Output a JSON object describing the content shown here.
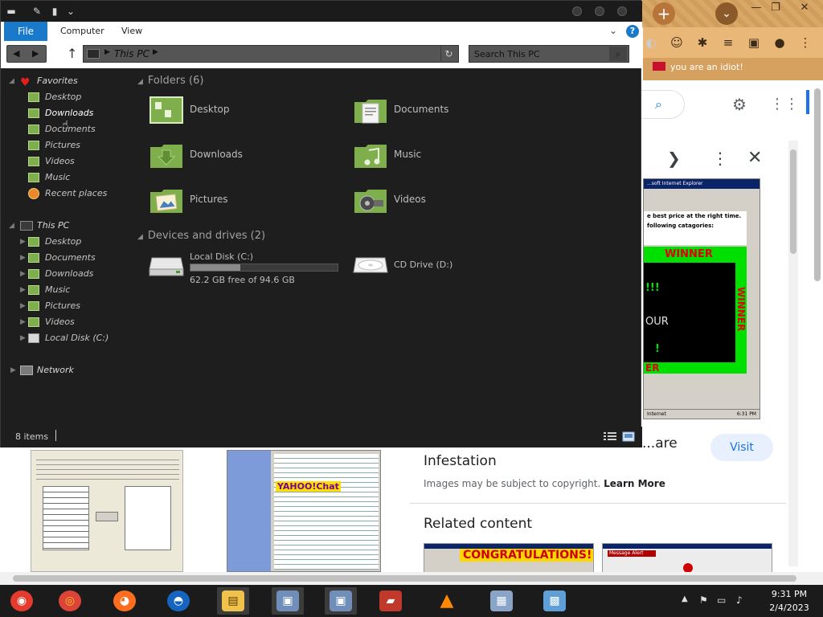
{
  "browser": {
    "new_tab_symbol": "+",
    "bookmark_text": "you are an idiot!",
    "viewer": {
      "prev_symbol": "❯",
      "winner_top": "WINNER",
      "winner_side": "WINNER",
      "winner_green": "!!!",
      "winner_mid": "OUR",
      "winner_bang": "!",
      "winner_bottom": "ER",
      "ie_title": "...soft Internet Explorer",
      "ie_line1": "e best price at the right time.",
      "ie_line2": "following catagories:",
      "ie_status_text": "Internet",
      "ie_status_time": "6:31 PM"
    },
    "result": {
      "title_line1": "...are",
      "title_line2": "Infestation",
      "visit_label": "Visit",
      "copyright_text": "Images may be subject to copyright.",
      "learn_more": "Learn More",
      "related_heading": "Related content",
      "congrats_text": "CONGRATULATIONS!",
      "message_alert": "Message Alert",
      "yahoo_text": "YAHOO!Chat"
    }
  },
  "explorer": {
    "ribbon": {
      "file_label": "File",
      "computer_label": "Computer",
      "view_label": "View",
      "help_label": "?"
    },
    "address": {
      "crumb": "This PC",
      "search_placeholder": "Search This PC"
    },
    "nav": {
      "favorites": "Favorites",
      "fav_items": [
        "Desktop",
        "Downloads",
        "Documents",
        "Pictures",
        "Videos",
        "Music",
        "Recent places"
      ],
      "this_pc": "This PC",
      "pc_items": [
        "Desktop",
        "Documents",
        "Downloads",
        "Music",
        "Pictures",
        "Videos",
        "Local Disk (C:)"
      ],
      "network": "Network"
    },
    "folders_heading": "Folders (6)",
    "folders": [
      "Desktop",
      "Documents",
      "Downloads",
      "Music",
      "Pictures",
      "Videos"
    ],
    "devices_heading": "Devices and drives (2)",
    "drives": {
      "local_name": "Local Disk (C:)",
      "local_free": "62.2 GB free of 94.6 GB",
      "local_used_fraction": 0.34,
      "cd_name": "CD Drive (D:)"
    },
    "status": {
      "item_count": "8 items"
    }
  },
  "taskbar": {
    "time": "9:31 PM",
    "date": "2/4/2023"
  },
  "colors": {
    "accent_blue": "#1979ca",
    "folder_green": "#7fae4c",
    "explorer_bg": "#1e1e1e"
  }
}
